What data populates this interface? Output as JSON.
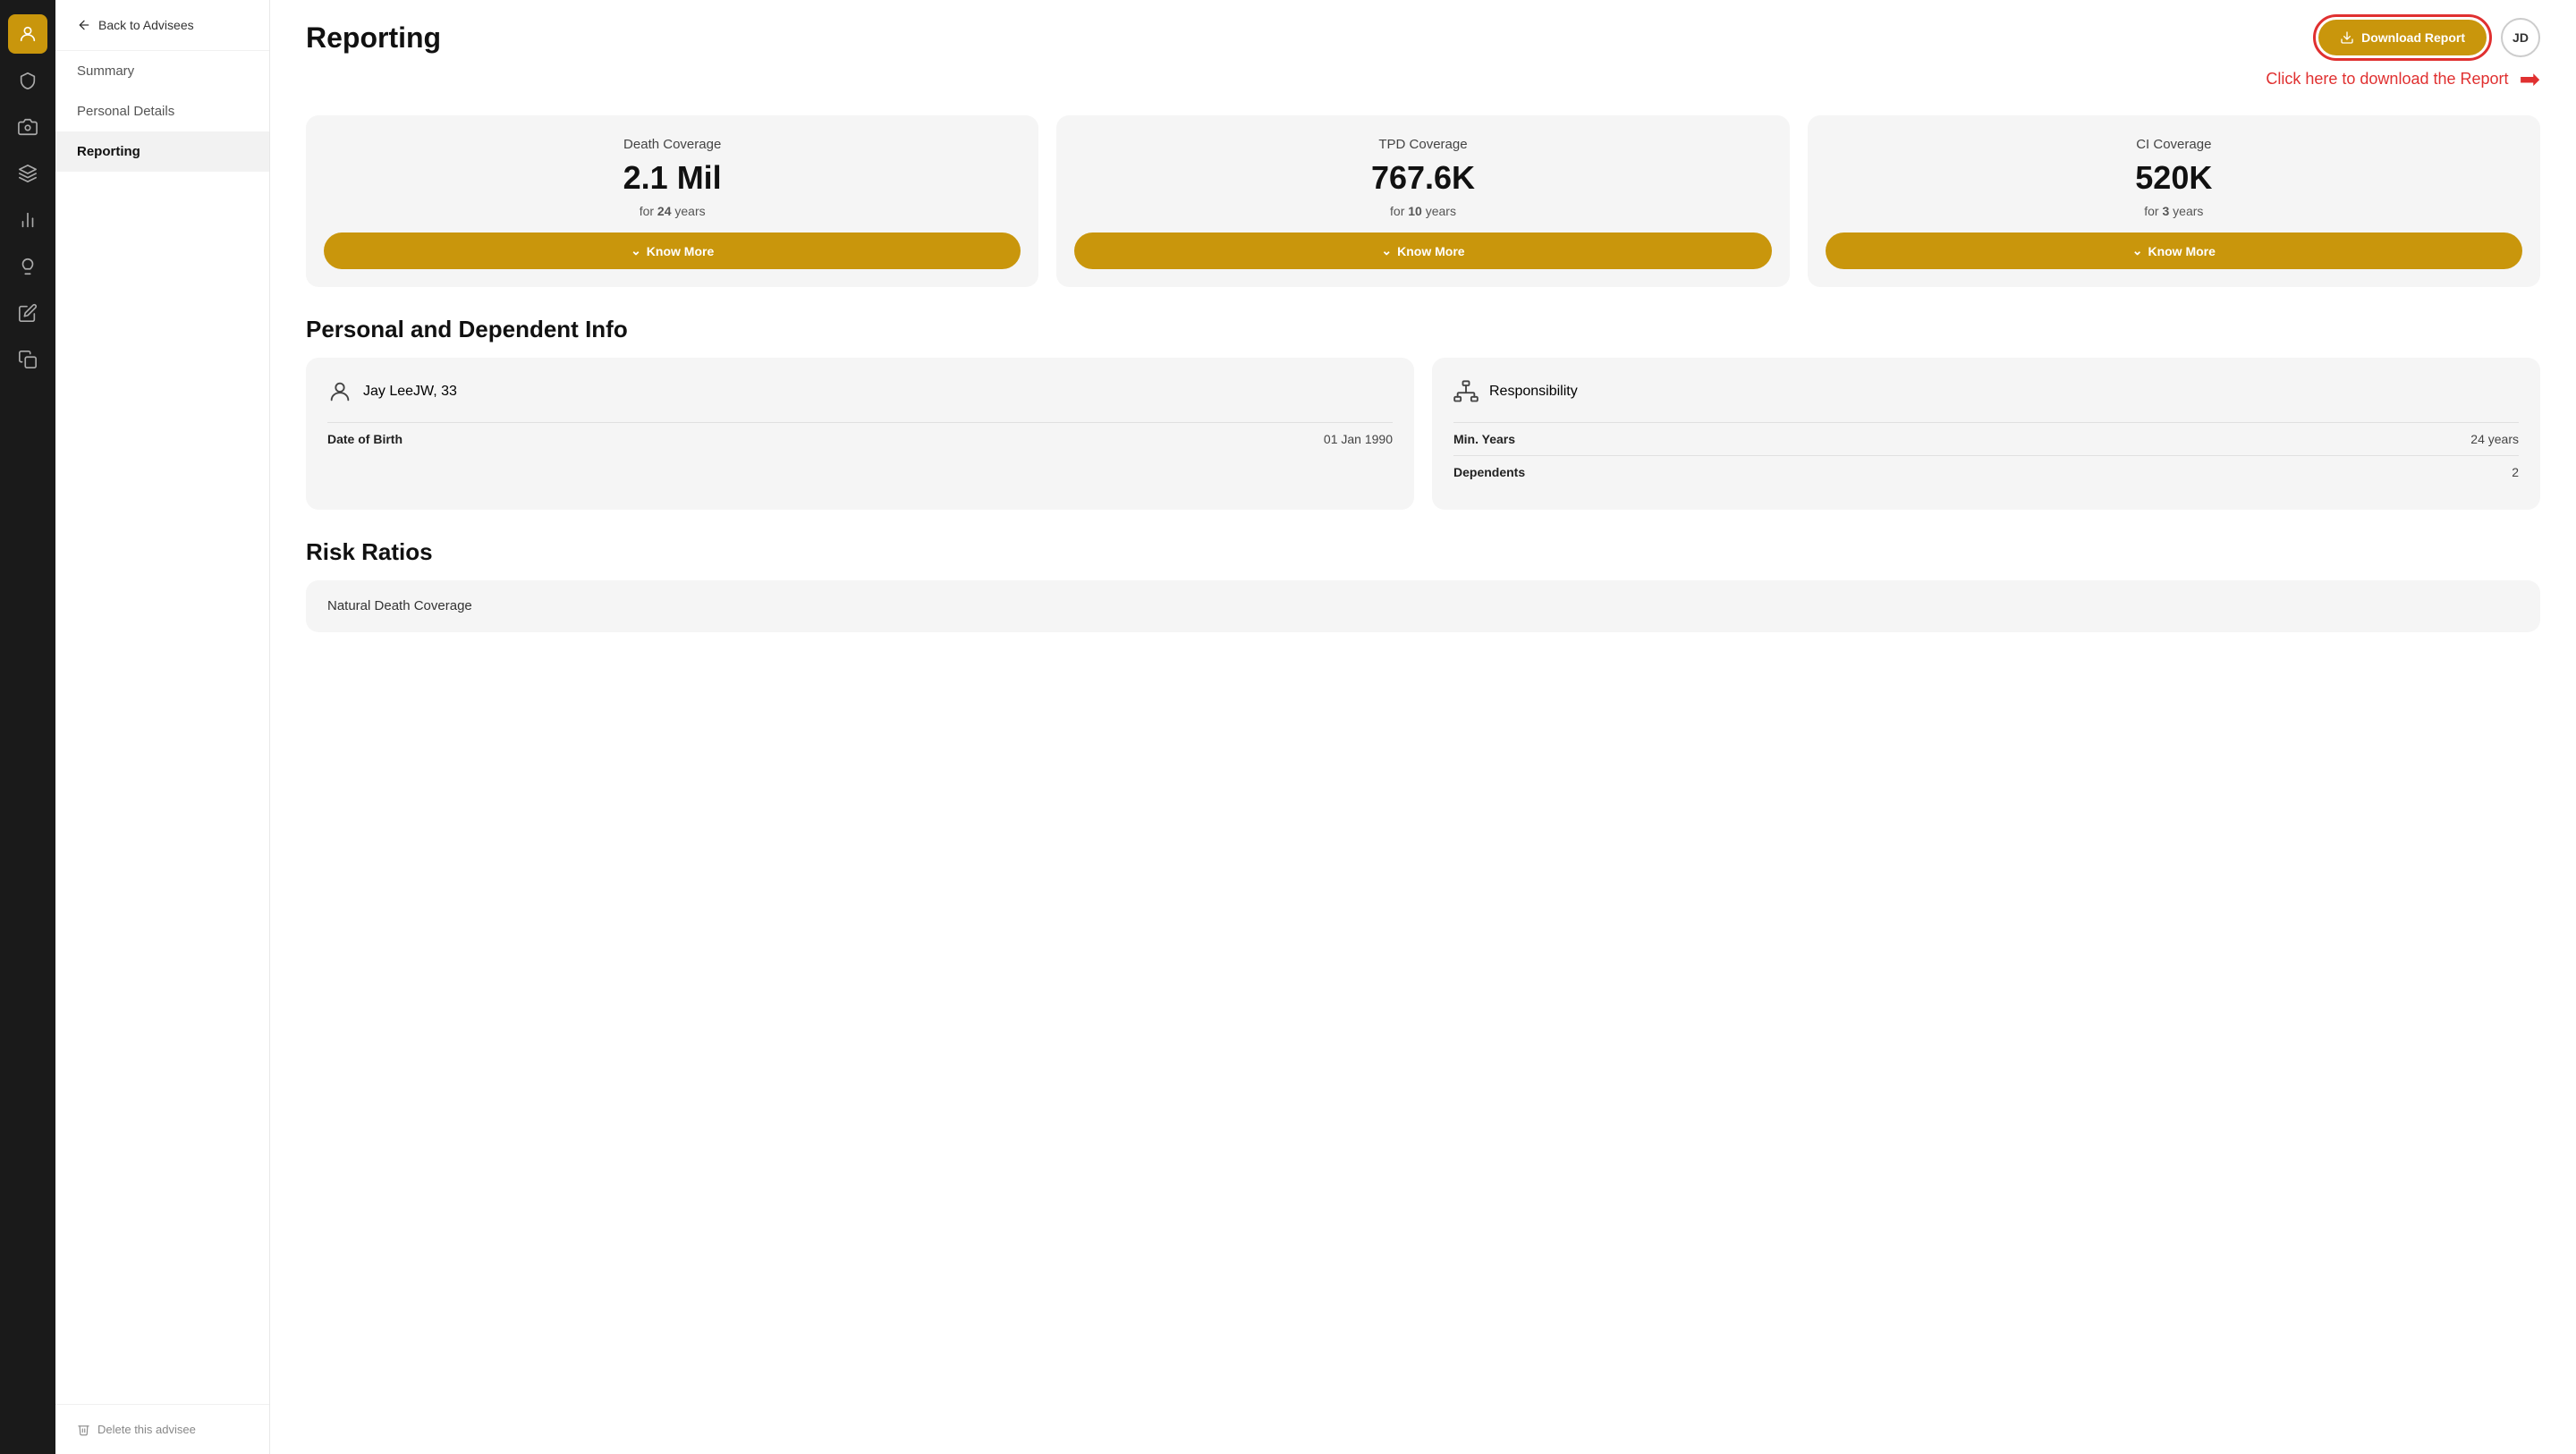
{
  "sidebar": {
    "icons": [
      {
        "name": "person-icon",
        "label": "Person",
        "active": true
      },
      {
        "name": "shield-icon",
        "label": "Shield",
        "active": false
      },
      {
        "name": "camera-icon",
        "label": "Camera",
        "active": false
      },
      {
        "name": "layers-icon",
        "label": "Layers",
        "active": false
      },
      {
        "name": "chart-icon",
        "label": "Chart",
        "active": false
      },
      {
        "name": "lightbulb-icon",
        "label": "Lightbulb",
        "active": false
      },
      {
        "name": "edit-icon",
        "label": "Edit",
        "active": false
      },
      {
        "name": "copy-icon",
        "label": "Copy",
        "active": false
      }
    ]
  },
  "nav": {
    "back_label": "Back to Advisees",
    "items": [
      {
        "label": "Summary",
        "active": false
      },
      {
        "label": "Personal Details",
        "active": false
      },
      {
        "label": "Reporting",
        "active": true
      }
    ],
    "delete_label": "Delete this advisee"
  },
  "header": {
    "title": "Reporting",
    "download_label": "Download Report",
    "avatar_initials": "JD"
  },
  "annotation": {
    "text": "Click here to download the Report"
  },
  "coverage_cards": [
    {
      "title": "Death Coverage",
      "value": "2.1 Mil",
      "years_label": "for",
      "years": "24",
      "years_suffix": "years",
      "know_more": "Know More"
    },
    {
      "title": "TPD Coverage",
      "value": "767.6K",
      "years_label": "for",
      "years": "10",
      "years_suffix": "years",
      "know_more": "Know More"
    },
    {
      "title": "CI Coverage",
      "value": "520K",
      "years_label": "for",
      "years": "3",
      "years_suffix": "years",
      "know_more": "Know More"
    }
  ],
  "personal_section": {
    "heading": "Personal and Dependent Info",
    "person_card": {
      "name": "Jay LeeJW, 33",
      "dob_label": "Date of Birth",
      "dob_value": "01 Jan 1990"
    },
    "responsibility_card": {
      "title": "Responsibility",
      "min_years_label": "Min. Years",
      "min_years_value": "24 years",
      "dependents_label": "Dependents",
      "dependents_value": "2"
    }
  },
  "risk_section": {
    "heading": "Risk Ratios",
    "natural_death_label": "Natural Death Coverage"
  }
}
